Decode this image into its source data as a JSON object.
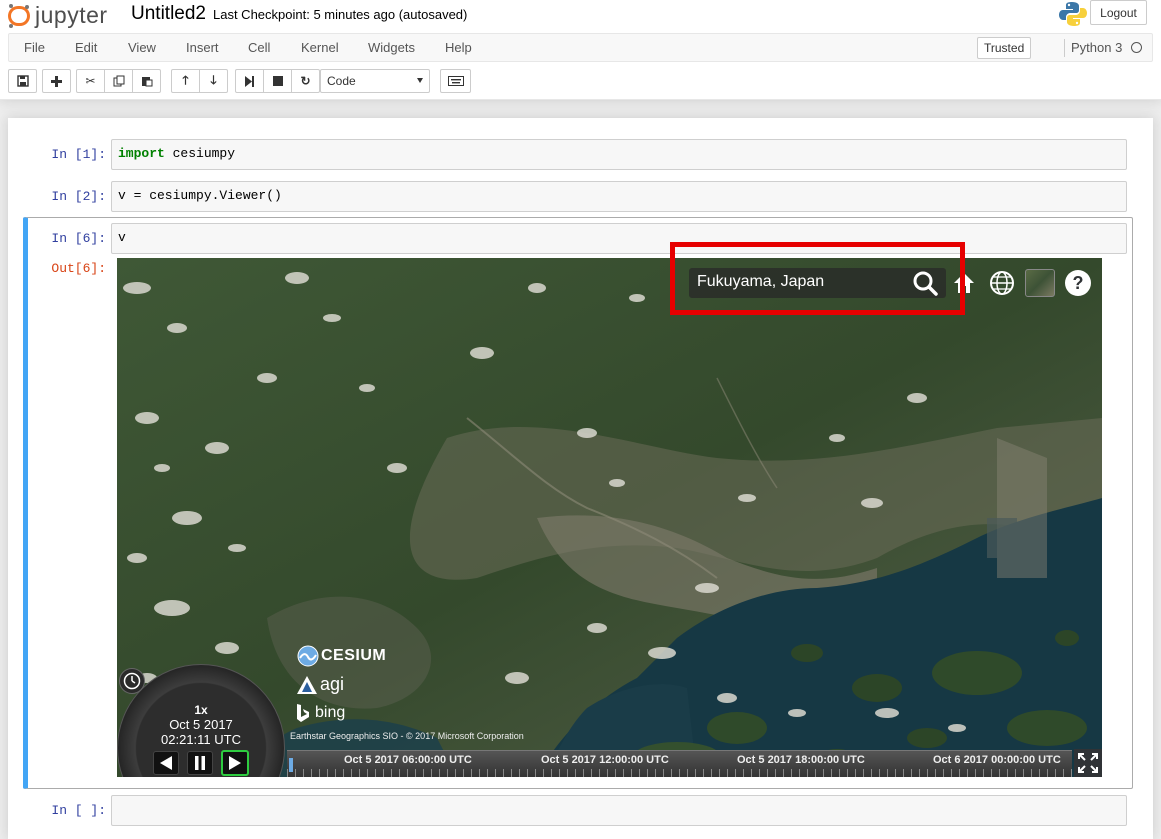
{
  "header": {
    "logo_text": "jupyter",
    "notebook_title": "Untitled2",
    "checkpoint": "Last Checkpoint: 5 minutes ago (autosaved)",
    "logout_label": "Logout"
  },
  "menubar": {
    "items": [
      "File",
      "Edit",
      "View",
      "Insert",
      "Cell",
      "Kernel",
      "Widgets",
      "Help"
    ],
    "trusted_label": "Trusted",
    "kernel_name": "Python 3"
  },
  "toolbar": {
    "celltype_value": "Code"
  },
  "cells": [
    {
      "prompt": "In [1]:",
      "code_kw": "import",
      "code_rest": " cesiumpy"
    },
    {
      "prompt": "In [2]:",
      "code": "v = cesiumpy.Viewer()"
    },
    {
      "prompt": "In [6]:",
      "code": "v",
      "out_prompt": "Out[6]:"
    },
    {
      "prompt": "In [ ]:",
      "code": ""
    }
  ],
  "viewer": {
    "geocoder_value": "Fukuyama, Japan",
    "speed": "1x",
    "date": "Oct 5 2017",
    "time": "02:21:11 UTC",
    "credits": {
      "cesium": "CESIUM",
      "agi": "agi",
      "bing": "bing",
      "imagery": "Earthstar Geographics SIO - © 2017 Microsoft Corporation"
    },
    "timeline_labels": [
      "Oct 5 2017 06:00:00 UTC",
      "Oct 5 2017 12:00:00 UTC",
      "Oct 5 2017 18:00:00 UTC",
      "Oct 6 2017 00:00:00 UTC"
    ],
    "highlight_color": "#e60000",
    "water_color": "#15313c",
    "land_color": "#3a5230"
  }
}
